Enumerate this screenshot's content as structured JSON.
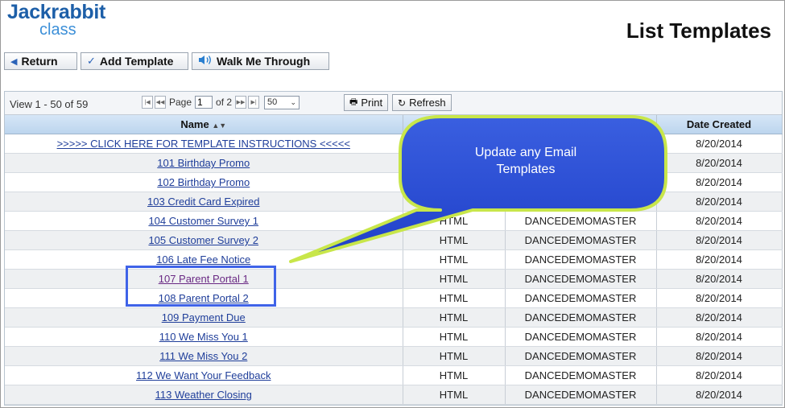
{
  "logo": {
    "main": "Jackrabbit",
    "sub": "class"
  },
  "page_title": "List Templates",
  "toolbar": {
    "return_label": "Return",
    "add_label": "Add Template",
    "walk_label": "Walk Me Through"
  },
  "pager": {
    "view_text": "View 1 - 50 of 59",
    "page_label": "Page",
    "page_value": "1",
    "of_label": "of 2",
    "per_page": "50",
    "print_label": "Print",
    "refresh_label": "Refresh"
  },
  "columns": {
    "name": "Name",
    "date_created": "Date Created"
  },
  "rows": [
    {
      "name": ">>>>> CLICK HERE FOR TEMPLATE INSTRUCTIONS <<<<<",
      "type": "",
      "owner": "",
      "date": "8/20/2014"
    },
    {
      "name": "101 Birthday Promo",
      "type": "",
      "owner": "",
      "date": "8/20/2014"
    },
    {
      "name": "102 Birthday Promo",
      "type": "",
      "owner": "",
      "date": "8/20/2014"
    },
    {
      "name": "103 Credit Card Expired",
      "type": "",
      "owner": "",
      "date": "8/20/2014"
    },
    {
      "name": "104 Customer Survey 1",
      "type": "HTML",
      "owner": "DANCEDEMOMASTER",
      "date": "8/20/2014"
    },
    {
      "name": "105 Customer Survey 2",
      "type": "HTML",
      "owner": "DANCEDEMOMASTER",
      "date": "8/20/2014"
    },
    {
      "name": "106 Late Fee Notice",
      "type": "HTML",
      "owner": "DANCEDEMOMASTER",
      "date": "8/20/2014"
    },
    {
      "name": "107 Parent Portal 1",
      "type": "HTML",
      "owner": "DANCEDEMOMASTER",
      "date": "8/20/2014"
    },
    {
      "name": "108 Parent Portal 2",
      "type": "HTML",
      "owner": "DANCEDEMOMASTER",
      "date": "8/20/2014"
    },
    {
      "name": "109 Payment Due",
      "type": "HTML",
      "owner": "DANCEDEMOMASTER",
      "date": "8/20/2014"
    },
    {
      "name": "110 We Miss You 1",
      "type": "HTML",
      "owner": "DANCEDEMOMASTER",
      "date": "8/20/2014"
    },
    {
      "name": "111 We Miss You 2",
      "type": "HTML",
      "owner": "DANCEDEMOMASTER",
      "date": "8/20/2014"
    },
    {
      "name": "112 We Want Your Feedback",
      "type": "HTML",
      "owner": "DANCEDEMOMASTER",
      "date": "8/20/2014"
    },
    {
      "name": "113 Weather Closing",
      "type": "HTML",
      "owner": "DANCEDEMOMASTER",
      "date": "8/20/2014"
    }
  ],
  "callout": {
    "line1": "Update any Email",
    "line2": "Templates"
  },
  "colors": {
    "accent": "#1f3e9a",
    "bubble_fill": "#2a4fd4",
    "bubble_stroke": "#c8e64a",
    "highlight": "#3f63e8"
  }
}
